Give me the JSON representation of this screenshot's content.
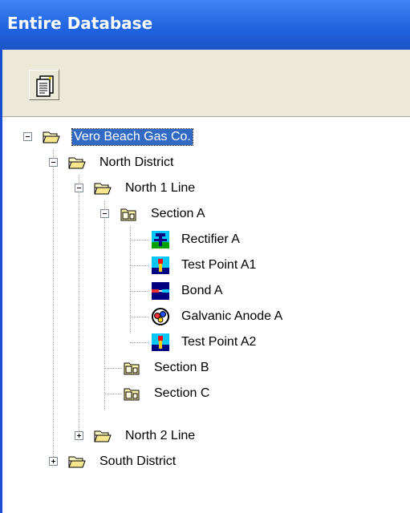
{
  "header": {
    "title": "Entire Database"
  },
  "toolbar": {
    "buttons": [
      {
        "icon": "report-icon"
      }
    ]
  },
  "tree": {
    "nodes": [
      {
        "label": "Vero Beach Gas Co.",
        "icon": "folder-open-icon",
        "expander": "minus",
        "selected": true
      },
      {
        "label": "North District",
        "icon": "folder-open-icon",
        "expander": "minus"
      },
      {
        "label": "North 1 Line",
        "icon": "folder-open-icon",
        "expander": "minus"
      },
      {
        "label": "Section A",
        "icon": "section-folder-icon",
        "expander": "minus"
      },
      {
        "label": "Rectifier A",
        "icon": "rectifier-icon"
      },
      {
        "label": "Test Point A1",
        "icon": "test-point-icon"
      },
      {
        "label": "Bond A",
        "icon": "bond-icon"
      },
      {
        "label": "Galvanic Anode A",
        "icon": "galvanic-anode-icon"
      },
      {
        "label": "Test Point A2",
        "icon": "test-point-icon"
      },
      {
        "label": "Section B",
        "icon": "section-folder-icon"
      },
      {
        "label": "Section C",
        "icon": "section-folder-icon"
      },
      {
        "label": "North 2 Line",
        "icon": "folder-open-icon",
        "expander": "plus"
      },
      {
        "label": "South District",
        "icon": "folder-open-icon",
        "expander": "plus"
      }
    ]
  },
  "colors": {
    "header_gradient_top": "#3f85f5",
    "header_gradient_bottom": "#1c55c8",
    "selection": "#316ac5",
    "toolbar_bg": "#ece9d8",
    "folder": "#f5e58c"
  }
}
